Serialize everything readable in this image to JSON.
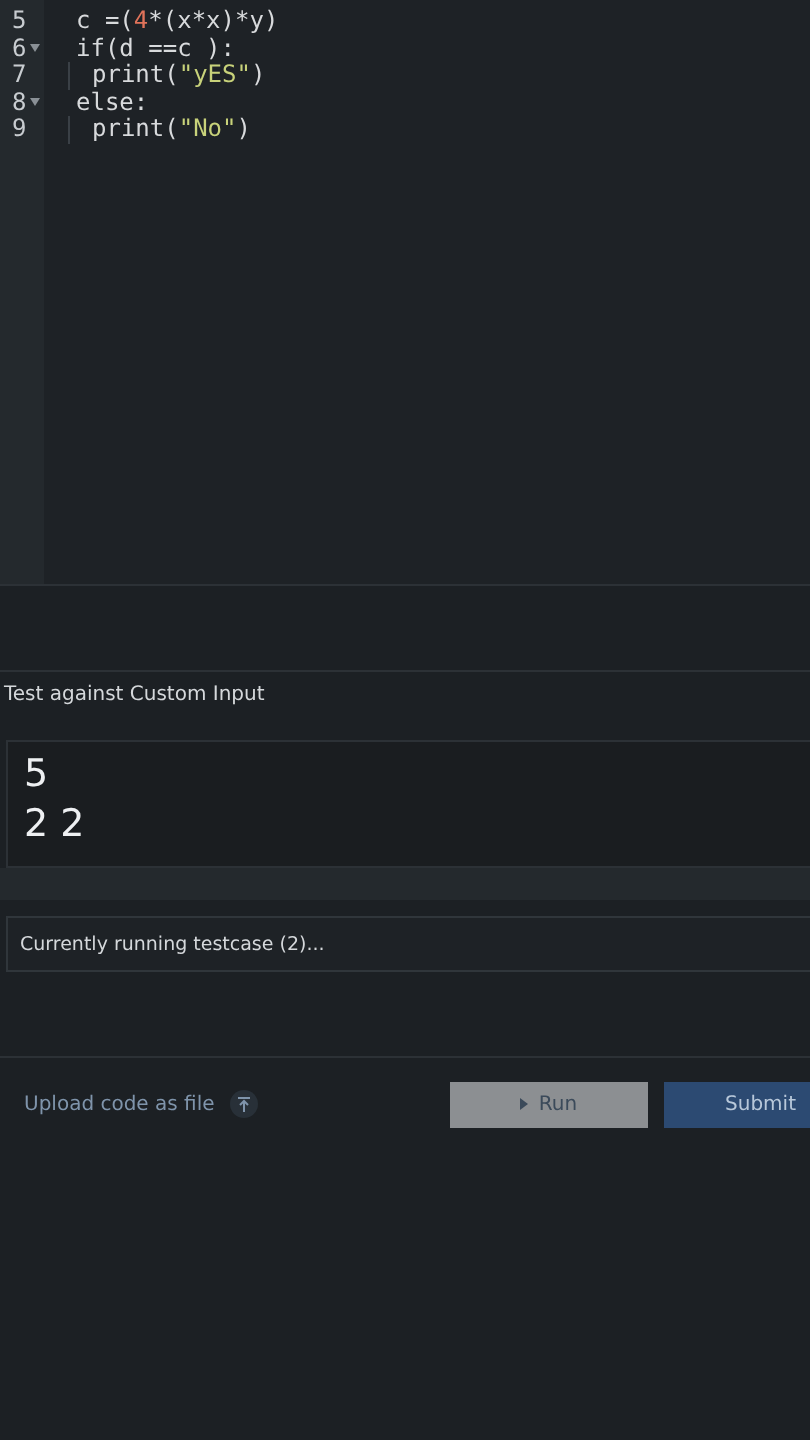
{
  "editor": {
    "lines": [
      {
        "number": "5",
        "foldable": false,
        "indent": false,
        "tokens": [
          {
            "kind": "plain",
            "text": "c =("
          },
          {
            "kind": "number",
            "text": "4"
          },
          {
            "kind": "plain",
            "text": "*(x*x)*y)"
          }
        ]
      },
      {
        "number": "6",
        "foldable": true,
        "indent": false,
        "tokens": [
          {
            "kind": "plain",
            "text": "if(d ==c ):"
          }
        ]
      },
      {
        "number": "7",
        "foldable": false,
        "indent": true,
        "tokens": [
          {
            "kind": "plain",
            "text": "print("
          },
          {
            "kind": "string",
            "text": "\"yES\""
          },
          {
            "kind": "plain",
            "text": ")"
          }
        ]
      },
      {
        "number": "8",
        "foldable": true,
        "indent": false,
        "tokens": [
          {
            "kind": "plain",
            "text": "else:"
          }
        ]
      },
      {
        "number": "9",
        "foldable": false,
        "indent": true,
        "tokens": [
          {
            "kind": "plain",
            "text": "print("
          },
          {
            "kind": "string",
            "text": "\"No\""
          },
          {
            "kind": "plain",
            "text": ")"
          }
        ]
      }
    ]
  },
  "custom_input": {
    "label": "Test against Custom Input",
    "value": "5\n2 2"
  },
  "status": {
    "text": "Currently running testcase (2)..."
  },
  "footer": {
    "upload_link": "Upload code as file",
    "run_button": "Run",
    "submit_button": "Submit"
  }
}
